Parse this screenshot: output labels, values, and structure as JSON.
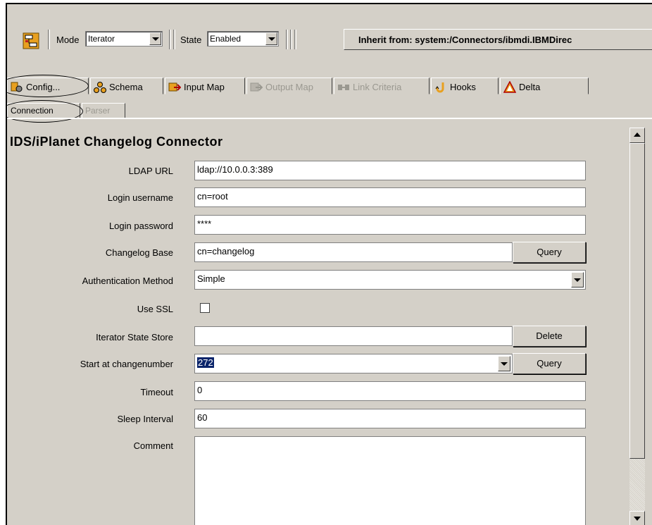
{
  "toolbar": {
    "connector_icon": "connector-icon",
    "mode_label": "Mode",
    "mode_value": "Iterator",
    "state_label": "State",
    "state_value": "Enabled",
    "inherit_text": "Inherit from: system:/Connectors/ibmdi.IBMDirec"
  },
  "tabs": [
    {
      "label": "Config...",
      "icon": "config-icon",
      "enabled": true
    },
    {
      "label": "Schema",
      "icon": "schema-icon",
      "enabled": true
    },
    {
      "label": "Input Map",
      "icon": "input-map-icon",
      "enabled": true
    },
    {
      "label": "Output Map",
      "icon": "output-map-icon",
      "enabled": false
    },
    {
      "label": "Link Criteria",
      "icon": "link-criteria-icon",
      "enabled": false
    },
    {
      "label": "Hooks",
      "icon": "hooks-icon",
      "enabled": true
    },
    {
      "label": "Delta",
      "icon": "delta-icon",
      "enabled": true
    }
  ],
  "subtabs": [
    {
      "label": "Connection",
      "enabled": true
    },
    {
      "label": "Parser",
      "enabled": false
    }
  ],
  "panel": {
    "title": "IDS/iPlanet Changelog Connector",
    "fields": {
      "ldap_url": {
        "label": "LDAP URL",
        "value": "ldap://10.0.0.3:389"
      },
      "login_username": {
        "label": "Login username",
        "value": "cn=root"
      },
      "login_password": {
        "label": "Login password",
        "value": "****"
      },
      "changelog_base": {
        "label": "Changelog Base",
        "value": "cn=changelog",
        "button": "Query"
      },
      "auth_method": {
        "label": "Authentication Method",
        "value": "Simple"
      },
      "use_ssl": {
        "label": "Use SSL",
        "checked": false
      },
      "iterator_state_store": {
        "label": "Iterator State Store",
        "value": "",
        "button": "Delete"
      },
      "start_changenumber": {
        "label": "Start at changenumber",
        "value": "272",
        "button": "Query"
      },
      "timeout": {
        "label": "Timeout",
        "value": "0"
      },
      "sleep_interval": {
        "label": "Sleep Interval",
        "value": "60"
      },
      "comment": {
        "label": "Comment",
        "value": ""
      }
    }
  }
}
